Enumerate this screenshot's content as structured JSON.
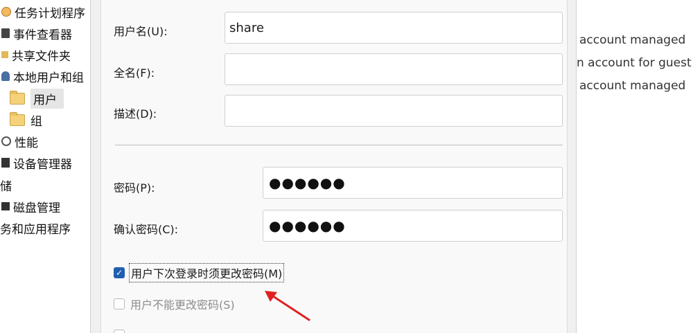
{
  "tree": {
    "items": [
      {
        "label": "任务计划程序",
        "icon": "clock-icon"
      },
      {
        "label": "事件查看器",
        "icon": "event-viewer-icon"
      },
      {
        "label": "共享文件夹",
        "icon": "shared-folder-icon"
      },
      {
        "label": "本地用户和组",
        "icon": "users-group-icon"
      },
      {
        "label": "用户",
        "icon": "folder-icon",
        "selected": true
      },
      {
        "label": "组",
        "icon": "folder-icon"
      },
      {
        "label": "性能",
        "icon": "performance-icon"
      },
      {
        "label": "设备管理器",
        "icon": "device-manager-icon"
      },
      {
        "label": "存储"
      },
      {
        "label": "磁盘管理",
        "icon": "disk-icon"
      },
      {
        "label": "服务和应用程序"
      }
    ],
    "items_visible_text": [
      "任务计划程序",
      "事件查看器",
      "共享文件夹",
      "本地用户和组",
      "用户",
      "组",
      "性能",
      "设备管理器",
      "储",
      "磁盘管理",
      "务和应用程序"
    ]
  },
  "background_list": {
    "rows": [
      "account managed",
      "n account for guest",
      "account managed"
    ]
  },
  "dialog": {
    "username_label": "用户名(U):",
    "username_value": "share",
    "fullname_label": "全名(F):",
    "fullname_value": "",
    "description_label": "描述(D):",
    "description_value": "",
    "password_label": "密码(P):",
    "password_dots": "●●●●●●",
    "confirm_label": "确认密码(C):",
    "confirm_dots": "●●●●●●",
    "must_change_label": "用户下次登录时须更改密码(M)",
    "must_change_checked": true,
    "cannot_change_label": "用户不能更改密码(S)",
    "cannot_change_checked": false
  },
  "annotation": {
    "arrow_color": "#e02020"
  }
}
